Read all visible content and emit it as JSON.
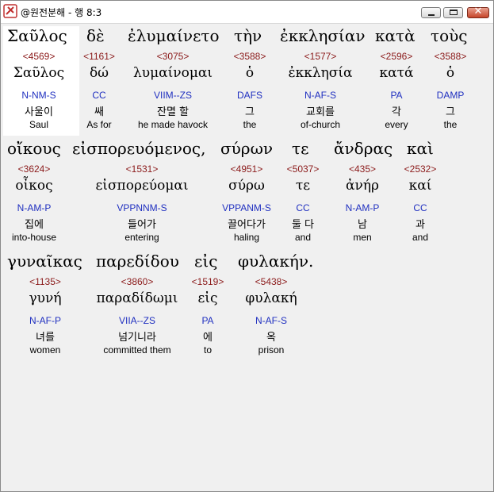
{
  "window": {
    "title": "@원전분해 - 행 8:3"
  },
  "lines": [
    {
      "words": [
        {
          "greek": "Σαῦλος",
          "strong": "<4569>",
          "lemma": "Σαῦλος",
          "parse": "N-NM-S",
          "korean": "사울이",
          "english": "Saul"
        },
        {
          "greek": "δὲ",
          "strong": "<1161>",
          "lemma": "δώ",
          "parse": "CC",
          "korean": "쌔",
          "english": "As for"
        },
        {
          "greek": "ἐλυμαίνετο",
          "strong": "<3075>",
          "lemma": "λυμαίνομαι",
          "parse": "VIIM--ZS",
          "korean": "잔멸 할",
          "english": "he made havock"
        },
        {
          "greek": "τὴν",
          "strong": "<3588>",
          "lemma": "ὁ",
          "parse": "DAFS",
          "korean": "그",
          "english": "the"
        },
        {
          "greek": "ἐκκλησίαν",
          "strong": "<1577>",
          "lemma": "ἐκκλησία",
          "parse": "N-AF-S",
          "korean": "교회를",
          "english": "of-church"
        },
        {
          "greek": "κατὰ",
          "strong": "<2596>",
          "lemma": "κατά",
          "parse": "PA",
          "korean": "각",
          "english": "every"
        },
        {
          "greek": "τοὺς",
          "strong": "<3588>",
          "lemma": "ὁ",
          "parse": "DAMP",
          "korean": "그",
          "english": "the"
        }
      ]
    },
    {
      "words": [
        {
          "greek": "οἴκους",
          "strong": "<3624>",
          "lemma": "οἶκος",
          "parse": "N-AM-P",
          "korean": "집에",
          "english": "into-house"
        },
        {
          "greek": "εἰσπορευόμενος,",
          "strong": "<1531>",
          "lemma": "εἰσπορεύομαι",
          "parse": "VPPNNM-S",
          "korean": "들어가",
          "english": "entering"
        },
        {
          "greek": "σύρων",
          "strong": "<4951>",
          "lemma": "σύρω",
          "parse": "VPPANM-S",
          "korean": "끌어다가",
          "english": "haling"
        },
        {
          "greek": "τε",
          "strong": "<5037>",
          "lemma": "τε",
          "parse": "CC",
          "korean": "둘 다",
          "english": "and"
        },
        {
          "greek": "ἄνδρας",
          "strong": "<435>",
          "lemma": "ἀνήρ",
          "parse": "N-AM-P",
          "korean": "남",
          "english": "men"
        },
        {
          "greek": "καὶ",
          "strong": "<2532>",
          "lemma": "καί",
          "parse": "CC",
          "korean": "과",
          "english": "and"
        }
      ]
    },
    {
      "words": [
        {
          "greek": "γυναῖκας",
          "strong": "<1135>",
          "lemma": "γυνή",
          "parse": "N-AF-P",
          "korean": "녀를",
          "english": "women"
        },
        {
          "greek": "παρεδίδου",
          "strong": "<3860>",
          "lemma": "παραδίδωμι",
          "parse": "VIIA--ZS",
          "korean": "넘기니라",
          "english": "committed them"
        },
        {
          "greek": "εἰς",
          "strong": "<1519>",
          "lemma": "εἰς",
          "parse": "PA",
          "korean": "에",
          "english": "to"
        },
        {
          "greek": "φυλακήν.",
          "strong": "<5438>",
          "lemma": "φυλακή",
          "parse": "N-AF-S",
          "korean": "옥",
          "english": "prison"
        }
      ]
    }
  ]
}
